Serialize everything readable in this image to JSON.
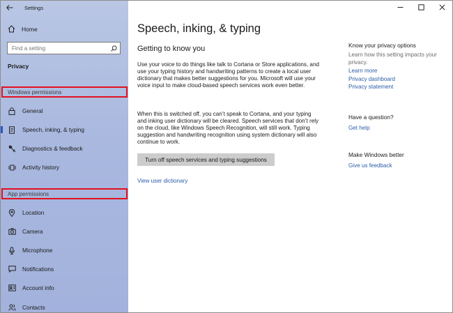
{
  "window": {
    "title": "Settings"
  },
  "sidebar": {
    "home_label": "Home",
    "search_placeholder": "Find a setting",
    "section_title": "Privacy",
    "windows_permissions_header": "Windows permissions",
    "windows_items": [
      {
        "label": "General",
        "icon": "lock-icon"
      },
      {
        "label": "Speech, inking, & typing",
        "icon": "document-icon",
        "active": true
      },
      {
        "label": "Diagnostics & feedback",
        "icon": "diagnostics-icon"
      },
      {
        "label": "Activity history",
        "icon": "activity-history-icon"
      }
    ],
    "app_permissions_header": "App permissions",
    "app_items": [
      {
        "label": "Location",
        "icon": "location-icon"
      },
      {
        "label": "Camera",
        "icon": "camera-icon"
      },
      {
        "label": "Microphone",
        "icon": "microphone-icon"
      },
      {
        "label": "Notifications",
        "icon": "notifications-icon"
      },
      {
        "label": "Account info",
        "icon": "account-info-icon"
      },
      {
        "label": "Contacts",
        "icon": "contacts-icon"
      }
    ]
  },
  "main": {
    "title": "Speech, inking, & typing",
    "subtitle": "Getting to know you",
    "paragraph1": "Use your voice to do things like talk to Cortana or Store applications, and use your typing history and handwriting patterns to create a local user dictionary that makes better suggestions for you. Microsoft will use your voice input to make cloud-based speech services work even better.",
    "paragraph2": "When this is switched off, you can’t speak to Cortana, and your typing and inking user dictionary will be cleared. Speech services that don’t rely on the cloud, like Windows Speech Recognition, will still work. Typing suggestion and handwriting recognition using system dictionary will also continue to work.",
    "turn_off_button": "Turn off speech services and typing suggestions",
    "view_dictionary_link": "View user dictionary"
  },
  "right_pane": {
    "privacy_heading": "Know your privacy options",
    "privacy_text": "Learn how this setting impacts your privacy.",
    "learn_more": "Learn more",
    "privacy_dashboard": "Privacy dashboard",
    "privacy_statement": "Privacy statement",
    "question_heading": "Have a question?",
    "get_help": "Get help",
    "better_heading": "Make Windows better",
    "feedback_link": "Give us feedback"
  },
  "colors": {
    "accent": "#2b5ba8",
    "highlight_box": "#e3101e",
    "sidebar_bg": "#a9b8df",
    "button_bg": "#cccccc"
  }
}
